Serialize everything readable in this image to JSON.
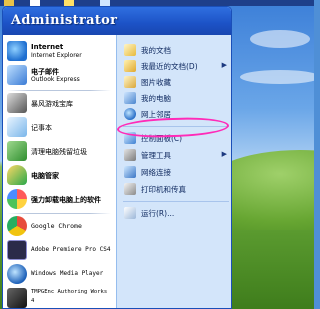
{
  "menu": {
    "user_name": "Administrator"
  },
  "left_items": [
    {
      "main": "Internet",
      "sub": "Internet Explorer",
      "icon": "internet-explorer-icon"
    },
    {
      "main": "电子邮件",
      "sub": "Outlook Express",
      "icon": "outlook-express-icon"
    },
    {
      "main": "暴风游戏宝库",
      "icon": "game-library-icon"
    },
    {
      "main": "记事本",
      "icon": "notepad-icon"
    },
    {
      "main": "清理电脑残留垃圾",
      "icon": "cleanup-icon"
    },
    {
      "main": "电脑管家",
      "icon": "pc-manager-icon"
    },
    {
      "main": "强力卸载电脑上的软件",
      "icon": "uninstall-icon"
    },
    {
      "main": "Google Chrome",
      "icon": "chrome-icon"
    },
    {
      "main": "Adobe Premiere Pro CS4",
      "icon": "premiere-icon"
    },
    {
      "main": "Windows Media Player",
      "icon": "media-player-icon"
    },
    {
      "main": "TMPGEnc Authoring Works",
      "sub": "4",
      "icon": "tmpgenc-icon"
    }
  ],
  "right_items": [
    {
      "label": "我的文档",
      "icon": "my-documents-icon",
      "arrow": ""
    },
    {
      "label": "我最近的文档(D)",
      "icon": "recent-documents-icon",
      "arrow": "▶"
    },
    {
      "label": "图片收藏",
      "icon": "my-pictures-icon",
      "arrow": ""
    },
    {
      "label": "我的电脑",
      "icon": "my-computer-icon",
      "arrow": ""
    },
    {
      "label": "网上邻居",
      "icon": "network-places-icon",
      "arrow": ""
    },
    {
      "label": "控制面板(C)",
      "icon": "control-panel-icon",
      "arrow": ""
    },
    {
      "label": "管理工具",
      "icon": "admin-tools-icon",
      "arrow": "▶"
    },
    {
      "label": "网络连接",
      "icon": "network-connections-icon",
      "arrow": ""
    },
    {
      "label": "打印机和传真",
      "icon": "printers-faxes-icon",
      "arrow": ""
    },
    {
      "label": "运行(R)...",
      "icon": "run-icon",
      "arrow": ""
    }
  ],
  "colors": {
    "header": "#1c52c6",
    "right_pane": "#d3e5fa",
    "highlight": "#ff2bb8"
  }
}
